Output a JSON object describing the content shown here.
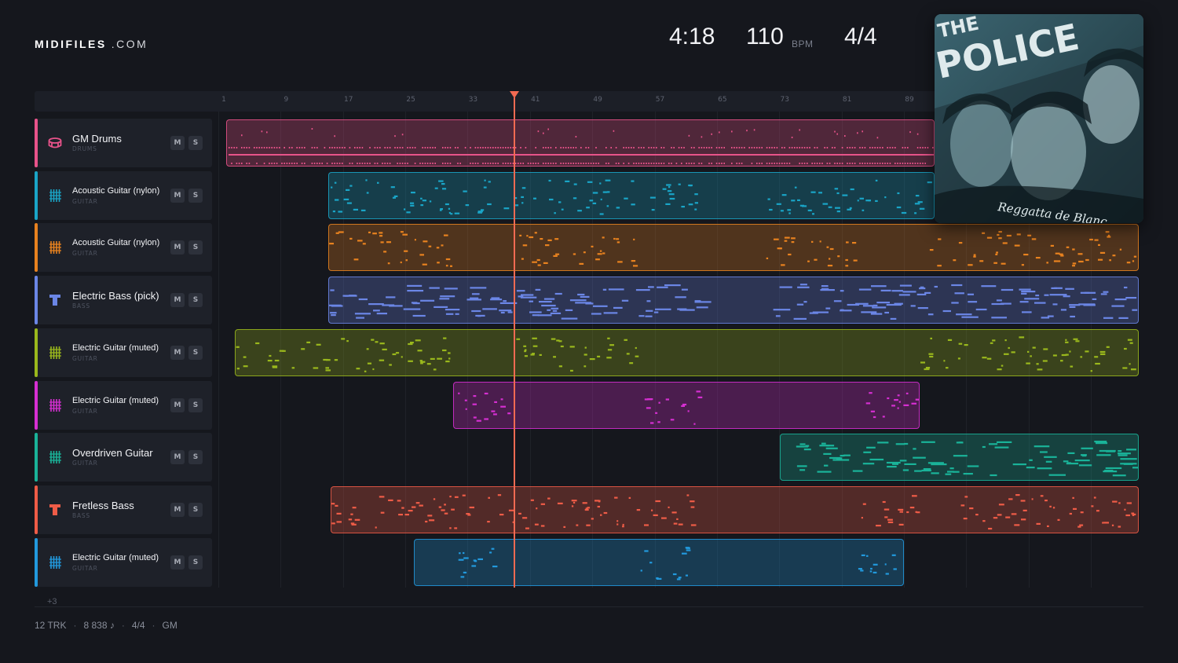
{
  "brand": {
    "name": "MIDIFILES",
    "suffix": ".COM"
  },
  "stats": {
    "duration": "4:18",
    "tempo": "110",
    "tempo_unit": "BPM",
    "time_signature": "4/4"
  },
  "album_art": {
    "band": [
      "THE",
      "POLICE"
    ],
    "album": "Reggatta de Blanc",
    "tint": "#2d4c55"
  },
  "ruler": {
    "ticks": [
      "1",
      "9",
      "17",
      "25",
      "33",
      "41",
      "49",
      "57",
      "65",
      "73",
      "81",
      "89"
    ],
    "playhead_bar": 38
  },
  "tracks": [
    {
      "name": "GM Drums",
      "category": "DRUMS",
      "color": "#e8538a",
      "icon": "drum-icon",
      "mute": "M",
      "solo": "S"
    },
    {
      "name": "Acoustic Guitar (nylon)",
      "category": "GUITAR",
      "color": "#1aa5c7",
      "icon": "guitar-icon",
      "mute": "M",
      "solo": "S"
    },
    {
      "name": "Acoustic Guitar (nylon)",
      "category": "GUITAR",
      "color": "#e8821f",
      "icon": "guitar-icon",
      "mute": "M",
      "solo": "S"
    },
    {
      "name": "Electric Bass (pick)",
      "category": "BASS",
      "color": "#6b86e6",
      "icon": "bass-icon",
      "mute": "M",
      "solo": "S"
    },
    {
      "name": "Electric Guitar (muted)",
      "category": "GUITAR",
      "color": "#9ab81c",
      "icon": "guitar-icon",
      "mute": "M",
      "solo": "S"
    },
    {
      "name": "Electric Guitar (muted)",
      "category": "GUITAR",
      "color": "#d62fd2",
      "icon": "guitar-icon",
      "mute": "M",
      "solo": "S"
    },
    {
      "name": "Overdriven Guitar",
      "category": "GUITAR",
      "color": "#1ab399",
      "icon": "guitar-icon",
      "mute": "M",
      "solo": "S"
    },
    {
      "name": "Fretless Bass",
      "category": "BASS",
      "color": "#ef5c47",
      "icon": "bass-icon",
      "mute": "M",
      "solo": "S"
    },
    {
      "name": "Electric Guitar (muted)",
      "category": "GUITAR",
      "color": "#2299dd",
      "icon": "guitar-icon",
      "mute": "M",
      "solo": "S"
    }
  ],
  "more_tracks": "+3",
  "footer": {
    "tracks": "12 TRK",
    "notes": "8 838 ♪",
    "time_signature": "4/4",
    "standard": "GM"
  }
}
